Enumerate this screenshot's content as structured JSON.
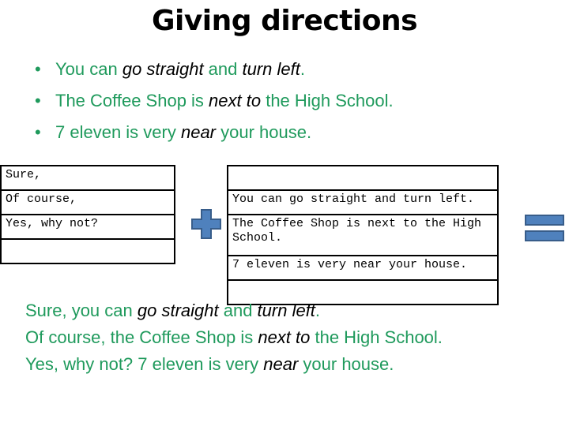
{
  "title": "Giving directions",
  "colors": {
    "accent_green": "#1f9a5c",
    "emphasis": "#000000",
    "icon_fill": "#4f81bd",
    "icon_border": "#385d8a"
  },
  "bullets": [
    {
      "segments": [
        {
          "text": "You can ",
          "style": "plain"
        },
        {
          "text": "go straight",
          "style": "em"
        },
        {
          "text": " and ",
          "style": "plain"
        },
        {
          "text": "turn left",
          "style": "em"
        },
        {
          "text": ".",
          "style": "plain"
        }
      ]
    },
    {
      "segments": [
        {
          "text": "The Coffee Shop is ",
          "style": "plain"
        },
        {
          "text": "next to",
          "style": "em"
        },
        {
          "text": " the High School.",
          "style": "plain"
        }
      ]
    },
    {
      "segments": [
        {
          "text": "7 eleven is very ",
          "style": "plain"
        },
        {
          "text": "near",
          "style": "em"
        },
        {
          "text": " your house.",
          "style": "plain"
        }
      ]
    }
  ],
  "left_table": {
    "rows": [
      "Sure,",
      "Of course,",
      "Yes, why not?",
      ""
    ]
  },
  "right_table": {
    "rows": [
      "",
      "You can go straight and turn left.",
      "The Coffee Shop is next to the High School.",
      "7 eleven is very near your house.",
      ""
    ]
  },
  "operators": {
    "plus": "plus-icon",
    "equals": "equals-icon"
  },
  "results": [
    {
      "segments": [
        {
          "text": "Sure, you can ",
          "style": "plain"
        },
        {
          "text": "go straight",
          "style": "em"
        },
        {
          "text": " and ",
          "style": "plain"
        },
        {
          "text": "turn left",
          "style": "em"
        },
        {
          "text": ".",
          "style": "plain"
        }
      ]
    },
    {
      "segments": [
        {
          "text": "Of course, the Coffee Shop is ",
          "style": "plain"
        },
        {
          "text": "next to",
          "style": "em"
        },
        {
          "text": " the High School.",
          "style": "plain"
        }
      ]
    },
    {
      "segments": [
        {
          "text": "Yes, why not? 7 eleven is very ",
          "style": "plain"
        },
        {
          "text": "near",
          "style": "em"
        },
        {
          "text": " your house.",
          "style": "plain"
        }
      ]
    }
  ]
}
